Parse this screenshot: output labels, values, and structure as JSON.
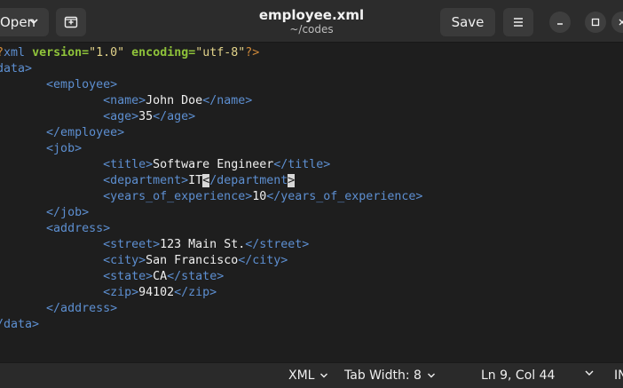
{
  "header": {
    "open_label": "Open",
    "title": "employee.xml",
    "subtitle": "~/codes",
    "save_label": "Save"
  },
  "editor": {
    "lines": [
      {
        "segments": [
          [
            "p",
            "<?"
          ],
          [
            "t",
            "xml"
          ],
          [
            "p",
            " "
          ],
          [
            "a",
            "version"
          ],
          [
            "a",
            "="
          ],
          [
            "s",
            "\"1.0\""
          ],
          [
            "p",
            " "
          ],
          [
            "a",
            "encoding"
          ],
          [
            "a",
            "="
          ],
          [
            "s",
            "\"utf-8\""
          ],
          [
            "p",
            "?>"
          ]
        ]
      },
      {
        "segments": [
          [
            "t",
            "<data>"
          ]
        ]
      },
      {
        "segments": [
          [
            "x",
            "        "
          ],
          [
            "t",
            "<employee>"
          ]
        ]
      },
      {
        "segments": [
          [
            "x",
            "                "
          ],
          [
            "t",
            "<name>"
          ],
          [
            "x",
            "John Doe"
          ],
          [
            "t",
            "</name>"
          ]
        ]
      },
      {
        "segments": [
          [
            "x",
            "                "
          ],
          [
            "t",
            "<age>"
          ],
          [
            "x",
            "35"
          ],
          [
            "t",
            "</age>"
          ]
        ]
      },
      {
        "segments": [
          [
            "x",
            "        "
          ],
          [
            "t",
            "</employee>"
          ]
        ]
      },
      {
        "segments": [
          [
            "x",
            "        "
          ],
          [
            "t",
            "<job>"
          ]
        ]
      },
      {
        "segments": [
          [
            "x",
            "                "
          ],
          [
            "t",
            "<title>"
          ],
          [
            "x",
            "Software Engineer"
          ],
          [
            "t",
            "</title>"
          ]
        ]
      },
      {
        "segments": [
          [
            "x",
            "                "
          ],
          [
            "t",
            "<department>"
          ],
          [
            "x",
            "IT"
          ],
          [
            "c",
            "<"
          ],
          [
            "t",
            "/department"
          ],
          [
            "c",
            ">"
          ]
        ]
      },
      {
        "segments": [
          [
            "x",
            "                "
          ],
          [
            "t",
            "<years_of_experience>"
          ],
          [
            "x",
            "10"
          ],
          [
            "t",
            "</years_of_experience>"
          ]
        ]
      },
      {
        "segments": [
          [
            "x",
            "        "
          ],
          [
            "t",
            "</job>"
          ]
        ]
      },
      {
        "segments": [
          [
            "x",
            "        "
          ],
          [
            "t",
            "<address>"
          ]
        ]
      },
      {
        "segments": [
          [
            "x",
            "                "
          ],
          [
            "t",
            "<street>"
          ],
          [
            "x",
            "123 Main St."
          ],
          [
            "t",
            "</street>"
          ]
        ]
      },
      {
        "segments": [
          [
            "x",
            "                "
          ],
          [
            "t",
            "<city>"
          ],
          [
            "x",
            "San Francisco"
          ],
          [
            "t",
            "</city>"
          ]
        ]
      },
      {
        "segments": [
          [
            "x",
            "                "
          ],
          [
            "t",
            "<state>"
          ],
          [
            "x",
            "CA"
          ],
          [
            "t",
            "</state>"
          ]
        ]
      },
      {
        "segments": [
          [
            "x",
            "                "
          ],
          [
            "t",
            "<zip>"
          ],
          [
            "x",
            "94102"
          ],
          [
            "t",
            "</zip>"
          ]
        ]
      },
      {
        "segments": [
          [
            "x",
            "        "
          ],
          [
            "t",
            "</address>"
          ]
        ]
      },
      {
        "segments": [
          [
            "t",
            "</data>"
          ]
        ]
      }
    ]
  },
  "statusbar": {
    "language": "XML",
    "tab_width": "Tab Width: 8",
    "position": "Ln 9, Col 44",
    "insert_mode": "INS"
  },
  "colors": {
    "tag": "#5d8fd1",
    "attribute": "#8fc33a",
    "string": "#e2d38a",
    "background": "#1e1e1e"
  },
  "icons": [
    "chevron-down-icon",
    "new-tab-icon",
    "hamburger-menu-icon",
    "minimize-icon",
    "maximize-icon",
    "close-icon"
  ]
}
